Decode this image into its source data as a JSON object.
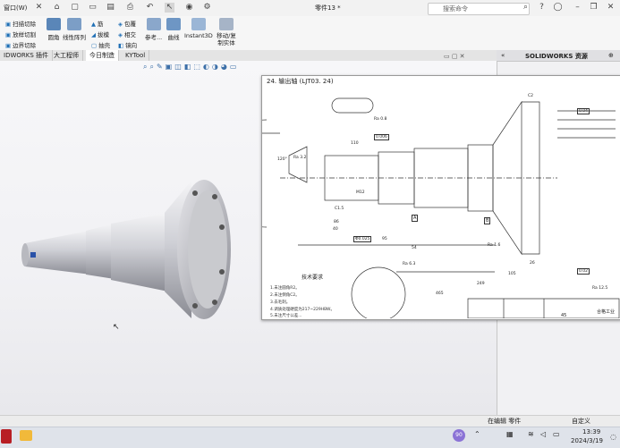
{
  "titlebar": {
    "menu_window": "窗口(W)",
    "doc_title": "零件13 *",
    "search_placeholder": "搜索命令"
  },
  "ribbon": {
    "sweep_cut": "扫描切除",
    "loft_cut": "放样切割",
    "boundary_cut": "边界切除",
    "fillet": "圆角",
    "linear_pattern": "线性阵列",
    "rib": "筋",
    "draft": "拔模",
    "shell": "抽壳",
    "wrap": "包覆",
    "intersect": "相交",
    "mirror": "镜向",
    "reference": "参考...",
    "curves": "曲线",
    "instant3d": "Instant3D",
    "move_copy_body": "移动/复制实体"
  },
  "tabs": [
    "IDWORKS 插件",
    "大工程师",
    "今日制造",
    "KYTool"
  ],
  "right_panel": {
    "title": "SOLIDWORKS 资源"
  },
  "drawing": {
    "title": "24. 输出轴 (LJT03. 24)",
    "tech_req_title": "技术要求",
    "notes": [
      "1.未注圆角R2。",
      "2.未注倒角C2。",
      "3.去毛刺。",
      "4.调质处理硬度为217~229HBW。",
      "5.未注尺寸公差..."
    ],
    "dims": [
      "110",
      "86",
      "40",
      "95",
      "54",
      "465",
      "249",
      "105",
      "26",
      "120°",
      "Ra 0.8",
      "Ra 3.2",
      "Ra 1.6",
      "Ra 6.3",
      "Ra 12.5",
      "Φ0.025",
      "0.02",
      "0.04",
      "0.006",
      "A",
      "B",
      "C2",
      "C1.5",
      "M12",
      "45",
      "合格工业"
    ]
  },
  "status": {
    "editing": "在编辑 零件",
    "custom": "自定义"
  },
  "taskbar": {
    "badge": "90",
    "time": "13:39",
    "date": "2024/3/19"
  }
}
